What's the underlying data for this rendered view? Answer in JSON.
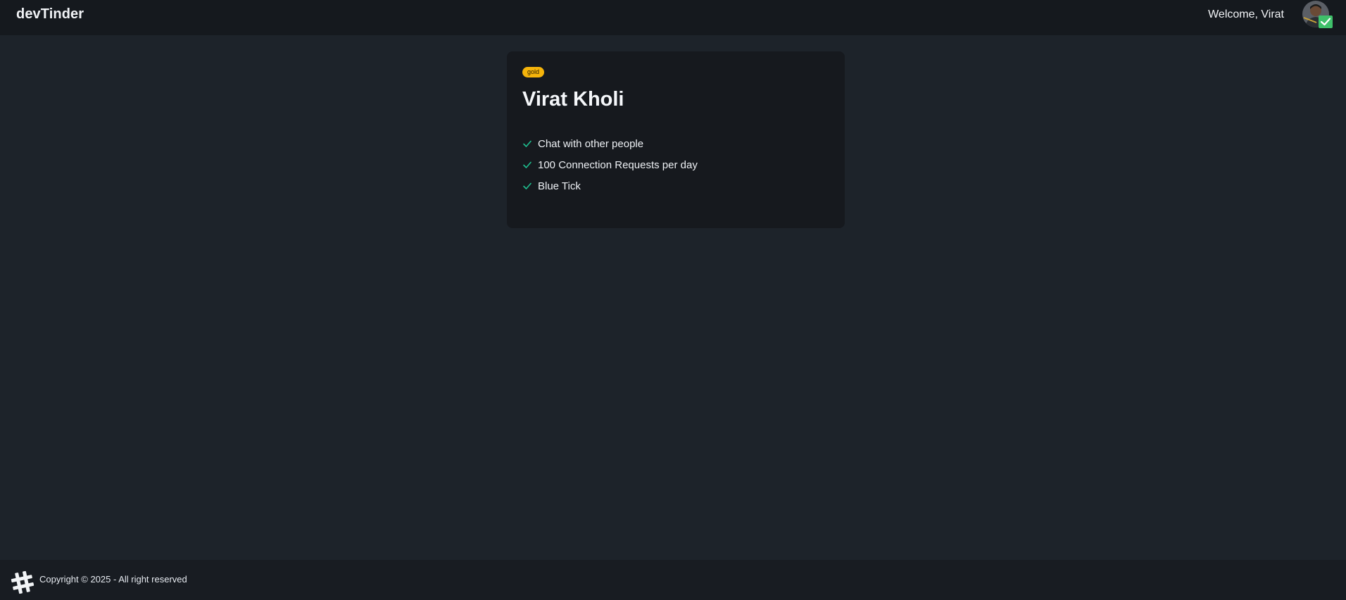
{
  "navbar": {
    "brand": "devTinder",
    "welcome_text": "Welcome, Virat",
    "avatar_icon": "user-avatar-verified"
  },
  "card": {
    "badge": "gold",
    "title": "Virat Kholi",
    "features": [
      "Chat with other people",
      "100 Connection Requests per day",
      "Blue Tick"
    ],
    "check_icon": "check-icon"
  },
  "footer": {
    "logo_icon": "hash-logo-icon",
    "copyright": "Copyright © 2025 - All right reserved"
  },
  "colors": {
    "page_bg": "#1d232a",
    "navbar_bg": "#15191e",
    "card_bg": "#16191e",
    "badge_bg": "#f5b40b",
    "check": "#1fbf8f"
  }
}
